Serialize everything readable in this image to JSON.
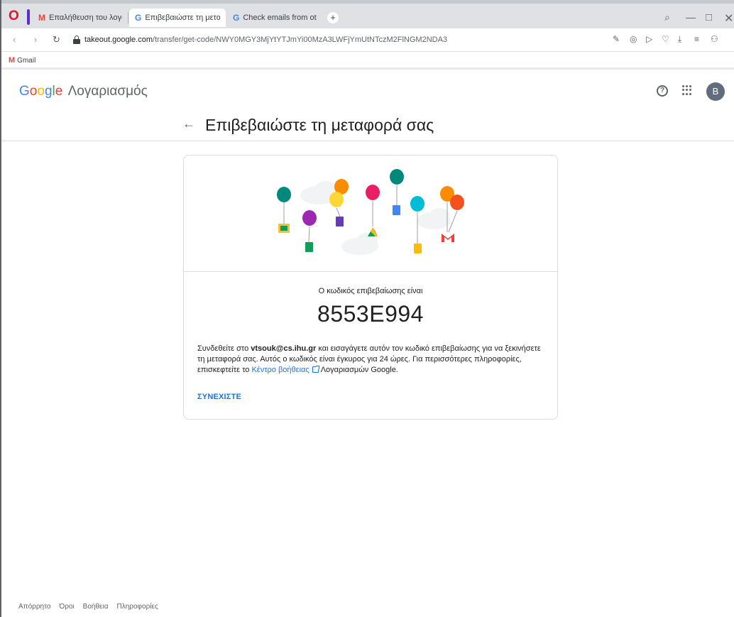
{
  "browser": {
    "tabs": [
      {
        "label": "Επαλήθευση του λογαριασ",
        "favicon": "gmail-icon",
        "active": false
      },
      {
        "label": "Επιβεβαιώστε τη μεταφορ",
        "favicon": "google-icon",
        "active": true
      },
      {
        "label": "Check emails from other a",
        "favicon": "google-icon",
        "active": false
      }
    ],
    "url_host": "takeout.google.com",
    "url_path": "/transfer/get-code/NWY0MGY3MjYtYTJmYi00MzA3LWFjYmUtNTczM2FlNGM2NDA3",
    "bookmark": "Gmail"
  },
  "header": {
    "logo_letters": [
      "G",
      "o",
      "o",
      "g",
      "l",
      "e"
    ],
    "product": "Λογαριασμός",
    "avatar_letter": "B"
  },
  "page": {
    "title": "Επιβεβαιώστε τη μεταφορά σας"
  },
  "card": {
    "code_label": "Ο κωδικός επιβεβαίωσης είναι",
    "code": "8553E994",
    "desc_1": "Συνδεθείτε στο ",
    "email": "vtsouk@cs.ihu.gr",
    "desc_2": " και εισαγάγετε αυτόν τον κωδικό επιβεβαίωσης για να ξεκινήσετε τη μεταφορά σας. Αυτός ο κωδικός είναι έγκυρος για 24 ώρες. Για περισσότερες πληροφορίες, επισκεφτείτε το ",
    "help_link": "Κέντρο βοήθειας",
    "desc_3": "Λογαριασμών Google.",
    "continue_label": "ΣΥΝΕΧΙΣΤΕ"
  },
  "footer": {
    "links": [
      "Απόρρητο",
      "Όροι",
      "Βοήθεια",
      "Πληροφορίες"
    ]
  }
}
